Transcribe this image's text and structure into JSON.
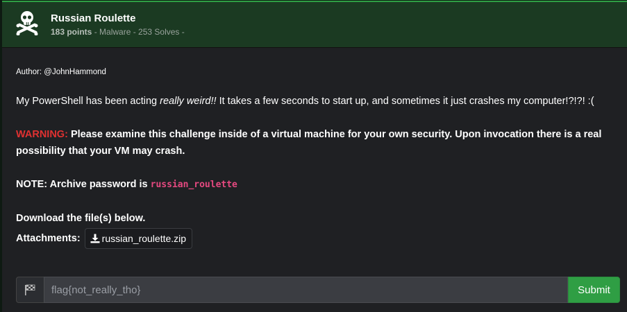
{
  "challenge": {
    "title": "Russian Roulette",
    "points": "183 points",
    "meta_rest": " - Malware - 253 Solves -",
    "icon": "skull-crossbones-icon"
  },
  "description": {
    "author": "Author: @JohnHammond",
    "intro_before": "My PowerShell has been acting ",
    "intro_emphasis": "really weird!!",
    "intro_after": " It takes a few seconds to start up, and sometimes it just crashes my computer!?!?! :(",
    "warning_label": "WARNING:",
    "warning_text": " Please examine this challenge inside of a virtual machine for your own security. Upon invocation there is a real possibility that your VM may crash.",
    "note_text": "NOTE: Archive password is ",
    "password": "russian_roulette",
    "download_text": "Download the file(s) below.",
    "attachments_label": "Attachments:",
    "attachment_name": "russian_roulette.zip"
  },
  "flag_form": {
    "placeholder": "flag{not_really_tho}",
    "submit_label": "Submit"
  },
  "colors": {
    "accent": "#2f9e44",
    "warning": "#e03131",
    "code": "#e64980"
  }
}
